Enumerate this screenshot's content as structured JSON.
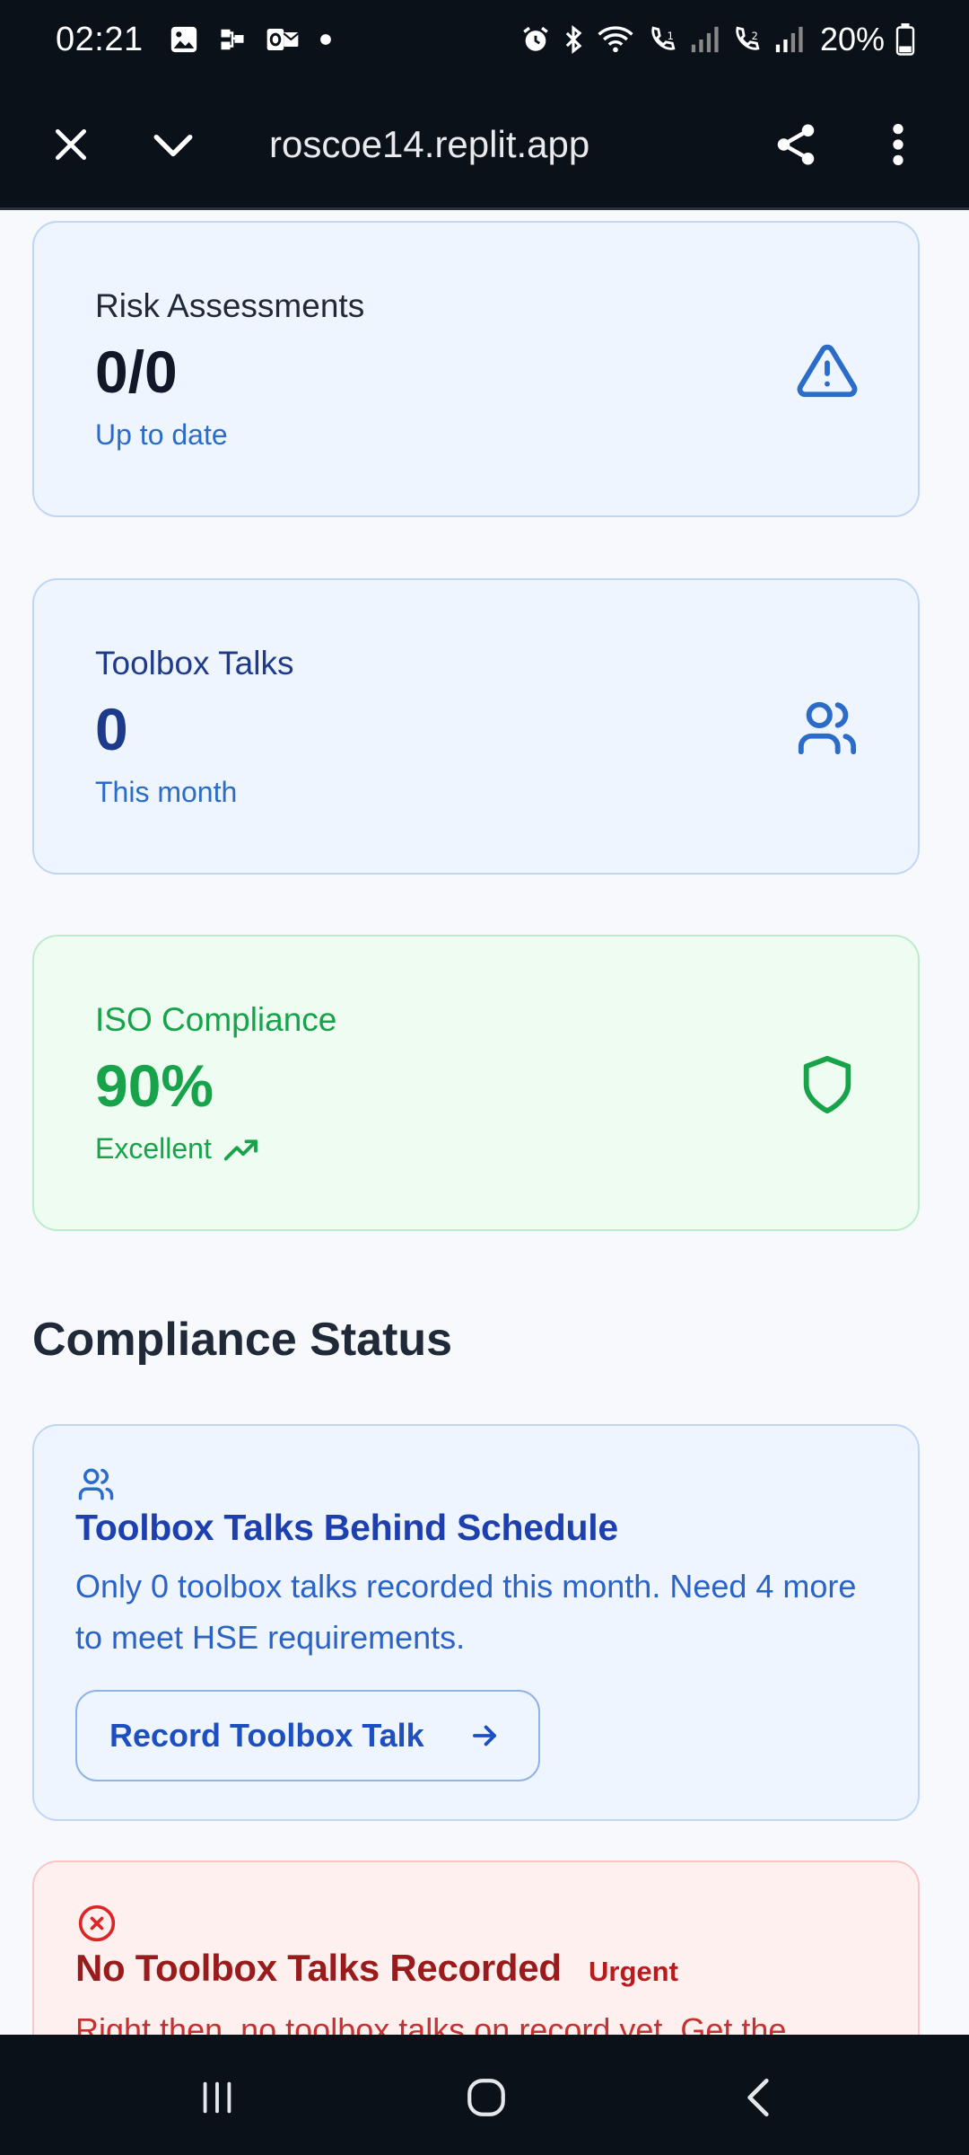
{
  "status_bar": {
    "time": "02:21",
    "battery_text": "20%"
  },
  "browser": {
    "url": "roscoe14.replit.app"
  },
  "stats": {
    "risk": {
      "label": "Risk Assessments",
      "value": "0/0",
      "sub": "Up to date",
      "icon": "alert-triangle-icon",
      "color": "#2b6cc9"
    },
    "toolbox": {
      "label": "Toolbox Talks",
      "value": "0",
      "sub": "This month",
      "icon": "users-icon",
      "color": "#2b6cc9"
    },
    "iso": {
      "label": "ISO Compliance",
      "value": "90%",
      "sub": "Excellent",
      "icon": "shield-icon",
      "color": "#16a34a"
    }
  },
  "compliance": {
    "title": "Compliance Status",
    "alerts": [
      {
        "icon": "users-icon",
        "title": "Toolbox Talks Behind Schedule",
        "body": "Only 0 toolbox talks recorded this month. Need 4 more to meet HSE requirements.",
        "button": "Record Toolbox Talk",
        "color": "#1e40af"
      },
      {
        "icon": "x-circle-icon",
        "title": "No Toolbox Talks Recorded",
        "badge": "Urgent",
        "body": "Right then, no toolbox talks on record yet. Get the",
        "color": "#991b1b"
      }
    ]
  }
}
